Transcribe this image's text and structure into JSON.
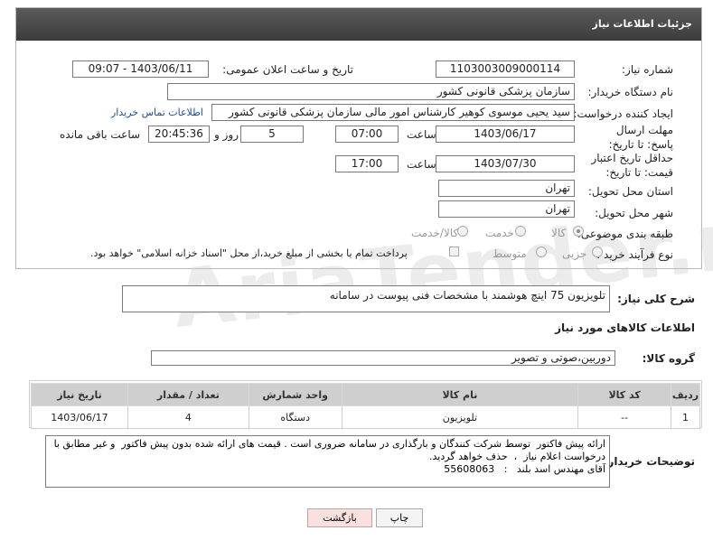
{
  "panel": {
    "title": "جزئیات اطلاعات نیاز"
  },
  "watermark": "AriaTender.neT",
  "fields": {
    "need_number_label": "شماره نیاز:",
    "need_number": "1103003009000114",
    "announce_label": "تاریخ و ساعت اعلان عمومی:",
    "announce_value": "1403/06/11 - 09:07",
    "buyer_org_label": "نام دستگاه خریدار:",
    "buyer_org": "سازمان پزشکی قانونی کشور",
    "requester_label": "ایجاد کننده درخواست:",
    "requester": "سید یحیی موسوی کوهیر کارشناس امور مالی سازمان پزشکی قانونی کشور",
    "contact_link": "اطلاعات تماس خریدار",
    "deadline_label": "مهلت ارسال پاسخ: تا تاریخ:",
    "deadline_date": "1403/06/17",
    "time_label": "ساعت",
    "deadline_time": "07:00",
    "days_value": "5",
    "days_label": "روز و",
    "remaining_time": "20:45:36",
    "remaining_label": "ساعت باقی مانده",
    "validity_label": "حداقل تاریخ اعتبار قیمت: تا تاریخ:",
    "validity_date": "1403/07/30",
    "validity_time": "17:00",
    "province_label": "استان محل تحویل:",
    "province": "تهران",
    "city_label": "شهر محل تحویل:",
    "city": "تهران",
    "category_label": "طبقه بندی موضوعی:",
    "category_options": [
      "کالا",
      "خدمت",
      "کالا/خدمت"
    ],
    "process_label": "نوع فرآیند خرید :",
    "process_options": [
      "جزیی",
      "متوسط"
    ],
    "payment_text": "پرداخت تمام یا بخشی از مبلغ خرید،از محل \"اسناد خزانه اسلامی\" خواهد بود."
  },
  "description": {
    "label": "شرح کلی نیاز:",
    "value": "تلویزیون 75 اینچ هوشمند با مشخصات فنی پیوست در سامانه"
  },
  "goods_section_title": "اطلاعات کالاهای مورد نیاز",
  "goods_group": {
    "label": "گروه کالا:",
    "value": "دوربین،صوتی و تصویر"
  },
  "table": {
    "headers": [
      "ردیف",
      "کد کالا",
      "نام کالا",
      "واحد شمارش",
      "تعداد / مقدار",
      "تاریخ نیاز"
    ],
    "rows": [
      [
        "1",
        "--",
        "تلویزیون",
        "دستگاه",
        "4",
        "1403/06/17"
      ]
    ]
  },
  "buyer_notes": {
    "label": "توضیحات خریدار:",
    "value": "ارائه پیش فاکتور  توسط شرکت کنندگان و بارگذاری در سامانه ضروری است . قیمت های ارائه شده بدون پیش فاکتور  و غیر مطابق با درخواست اعلام نیاز  ،  حذف خواهد گردید.\nآقای مهندس اسد بلند   :   55608063"
  },
  "buttons": {
    "print": "چاپ",
    "back": "بازگشت"
  },
  "colors": {
    "header_bg": "#4a4a4a",
    "link": "#1f4fa3",
    "back_button": "#fbe0e0",
    "table_header": "#cfcfcf"
  }
}
